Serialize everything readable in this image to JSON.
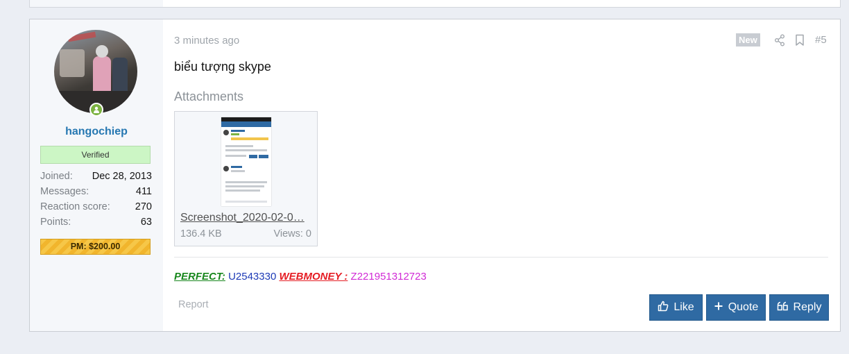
{
  "user": {
    "username": "hangochiep",
    "banner": "Verified",
    "stats": [
      {
        "label": "Joined:",
        "value": "Dec 28, 2013"
      },
      {
        "label": "Messages:",
        "value": "411"
      },
      {
        "label": "Reaction score:",
        "value": "270"
      },
      {
        "label": "Points:",
        "value": "63"
      }
    ],
    "pm_badge": "PM: $200.00"
  },
  "post": {
    "time": "3 minutes ago",
    "new_label": "New",
    "number": "#5",
    "message": "biểu tượng skype",
    "attachments_title": "Attachments",
    "attachment": {
      "name": "Screenshot_2020-02-0…",
      "size": "136.4 KB",
      "views": "Views: 0"
    },
    "signature": {
      "perfect_label": "PERFECT:",
      "perfect_id": "U2543330",
      "webmoney_label": "WEBMONEY :",
      "webmoney_id": "Z221951312723"
    },
    "report_label": "Report"
  },
  "actions": {
    "like": "Like",
    "quote": "Quote",
    "reply": "Reply"
  },
  "colors": {
    "accent": "#2f6aa3",
    "username": "#2577b1",
    "verified_bg": "#ccf6c5",
    "online": "#7cb342"
  }
}
